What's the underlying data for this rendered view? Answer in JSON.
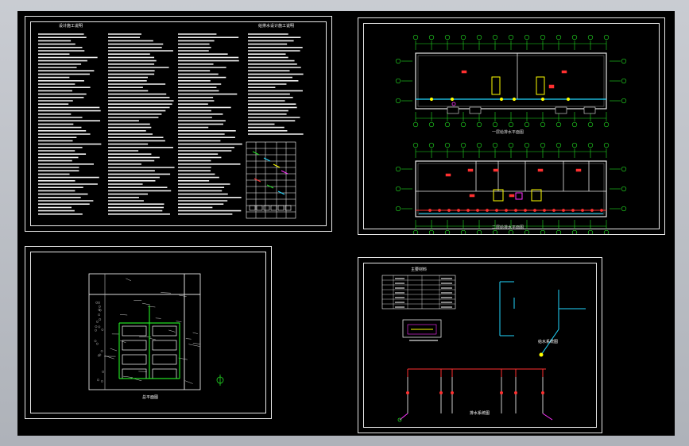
{
  "app": {
    "background_color": "#000000",
    "line_color": "#ffffff"
  },
  "sheets": [
    {
      "id": "notes",
      "title_left": "设计施工说明",
      "title_right": "给排水设计施工说明"
    },
    {
      "id": "floor-plans",
      "plan_top_caption": "一层给排水平面图",
      "plan_bottom_caption": "二层给排水平面图"
    },
    {
      "id": "site-plan",
      "caption": "总平面图"
    },
    {
      "id": "system",
      "legend_title": "主要材料",
      "caption_riser": "给水系统图",
      "caption_bottom": "排水系统图"
    }
  ],
  "colors": {
    "grid_green": "#22dd22",
    "wall_white": "#e6e6e6",
    "pipe_cyan": "#22d8ff",
    "pipe_red": "#ff3030",
    "fixture_yellow": "#ffff00",
    "pipe_magenta": "#ff30ff"
  }
}
